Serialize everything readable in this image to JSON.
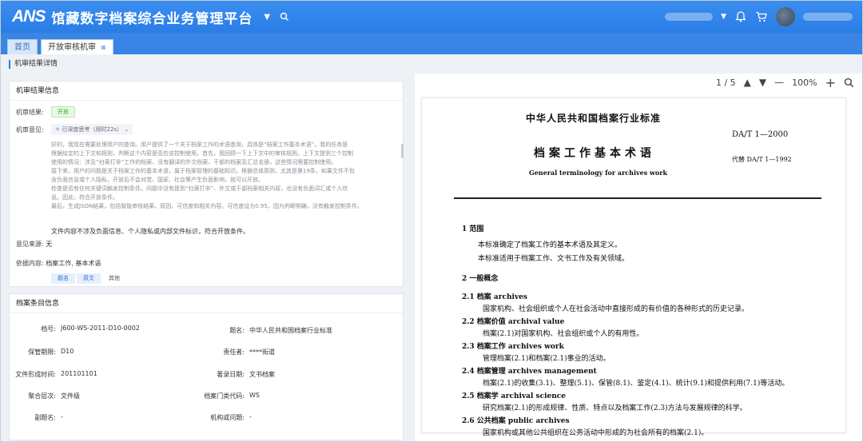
{
  "header": {
    "logo": "ANS",
    "title": "馆藏数字档案综合业务管理平台"
  },
  "tabs": [
    {
      "label": "首页"
    },
    {
      "label": "开放审核机审"
    }
  ],
  "breadcrumb": "机审结果详情",
  "result": {
    "section_title": "机审结果信息",
    "result_label": "机审结果:",
    "result_value": "开放",
    "opinion_label": "机审意见:",
    "deep_label": "已深度思考（用时22s）",
    "thought_lines": [
      "好的，我现在需要处理用户的查询。用户提供了一个关于档案工作的术语查询，具体是“档案工作基本术语”。我的任务是",
      "根据给定的上下文和规则，判断这个内容是否应该控制使用。首先，我回顾一下上下文中的审核规则。上下文提到三个控制",
      "使用的情况：涉及“扫黄打非”工作的档案、没有翻译的外文档案、干部的档案及汇总名册，这些情况需要控制使用。",
      "接下来，用户的问题是关于档案工作的基本术语，属于档案管理的基础知识。根据总体原则，尤其是第19条，如果文件不包",
      "含负面信息或个人隐私，开放后不会对党、国家、社会等产生负面影响，就可以开放。",
      "检查是否有任何关键词触发控制条件。问题中没有提到“扫黄打非”、外文或干部档案相关内容，也没有负面词汇或个人信",
      "息。因此，符合开放条件。",
      "最后，生成JSON结果，包括智能审核结果、原因、可信度和相关内容。可信度设为0.95，因为判断明确，没有触发控制条件。"
    ],
    "conclusion": "文件内容不涉及负面信息、个人隐私或内部文件标识，符合开放条件。",
    "source_label": "意见来源:",
    "source_value": "无",
    "basis_label": "依据内容:",
    "basis_value": "档案工作, 基本术语",
    "buttons": [
      "题名",
      "原文",
      "其他"
    ]
  },
  "archive": {
    "section_title": "档案条目信息",
    "fields": [
      {
        "label": "档号:",
        "value": "J600-WS-2011-D10-0002"
      },
      {
        "label": "题名:",
        "value": "中华人民共和国档案行业标准"
      },
      {
        "label": "保管期限:",
        "value": "D10"
      },
      {
        "label": "责任者:",
        "value": "****街道"
      },
      {
        "label": "文件形成时间:",
        "value": "201101101"
      },
      {
        "label": "著录日期:",
        "value": "文书档案"
      },
      {
        "label": "聚合层次:",
        "value": "文件级"
      },
      {
        "label": "档案门类代码:",
        "value": "WS"
      },
      {
        "label": "副题名:",
        "value": "-"
      },
      {
        "label": "机构或问题:",
        "value": "-"
      }
    ]
  },
  "viewer": {
    "page": "1 / 5",
    "zoom": "100%"
  },
  "doc": {
    "header": "中华人民共和国档案行业标准",
    "code": "DA/T 1—2000",
    "title": "档案工作基本术语",
    "subtitle": "General terminology for archives work",
    "replaces": "代替 DA/T 1—1992",
    "s1": "1  范围",
    "s1a": "本标准确定了档案工作的基本术语及其定义。",
    "s1b": "本标准适用于档案工作、文书工作及有关领域。",
    "s2": "2  一般概念",
    "t21": "2.1  档案    archives",
    "d21": "国家机构、社会组织或个人在社会活动中直接形成的有价值的各种形式的历史记录。",
    "t22": "2.2  档案价值    archival value",
    "d22": "档案(2.1)对国家机构、社会组织或个人的有用性。",
    "t23": "2.3  档案工作    archives work",
    "d23": "管理档案(2.1)和档案(2.1)事业的活动。",
    "t24": "2.4  档案管理    archives management",
    "d24": "档案(2.1)的收集(3.1)、整理(5.1)、保管(8.1)、鉴定(4.1)、统计(9.1)和提供利用(7.1)等活动。",
    "t25": "2.5  档案学    archival science",
    "d25": "研究档案(2.1)的形成规律、性质、特点以及档案工作(2.3)方法与发展规律的科学。",
    "t26": "2.6  公共档案    public archives",
    "d26": "国家机构或其他公共组织在公务活动中形成的为社会所有的档案(2.1)。"
  }
}
